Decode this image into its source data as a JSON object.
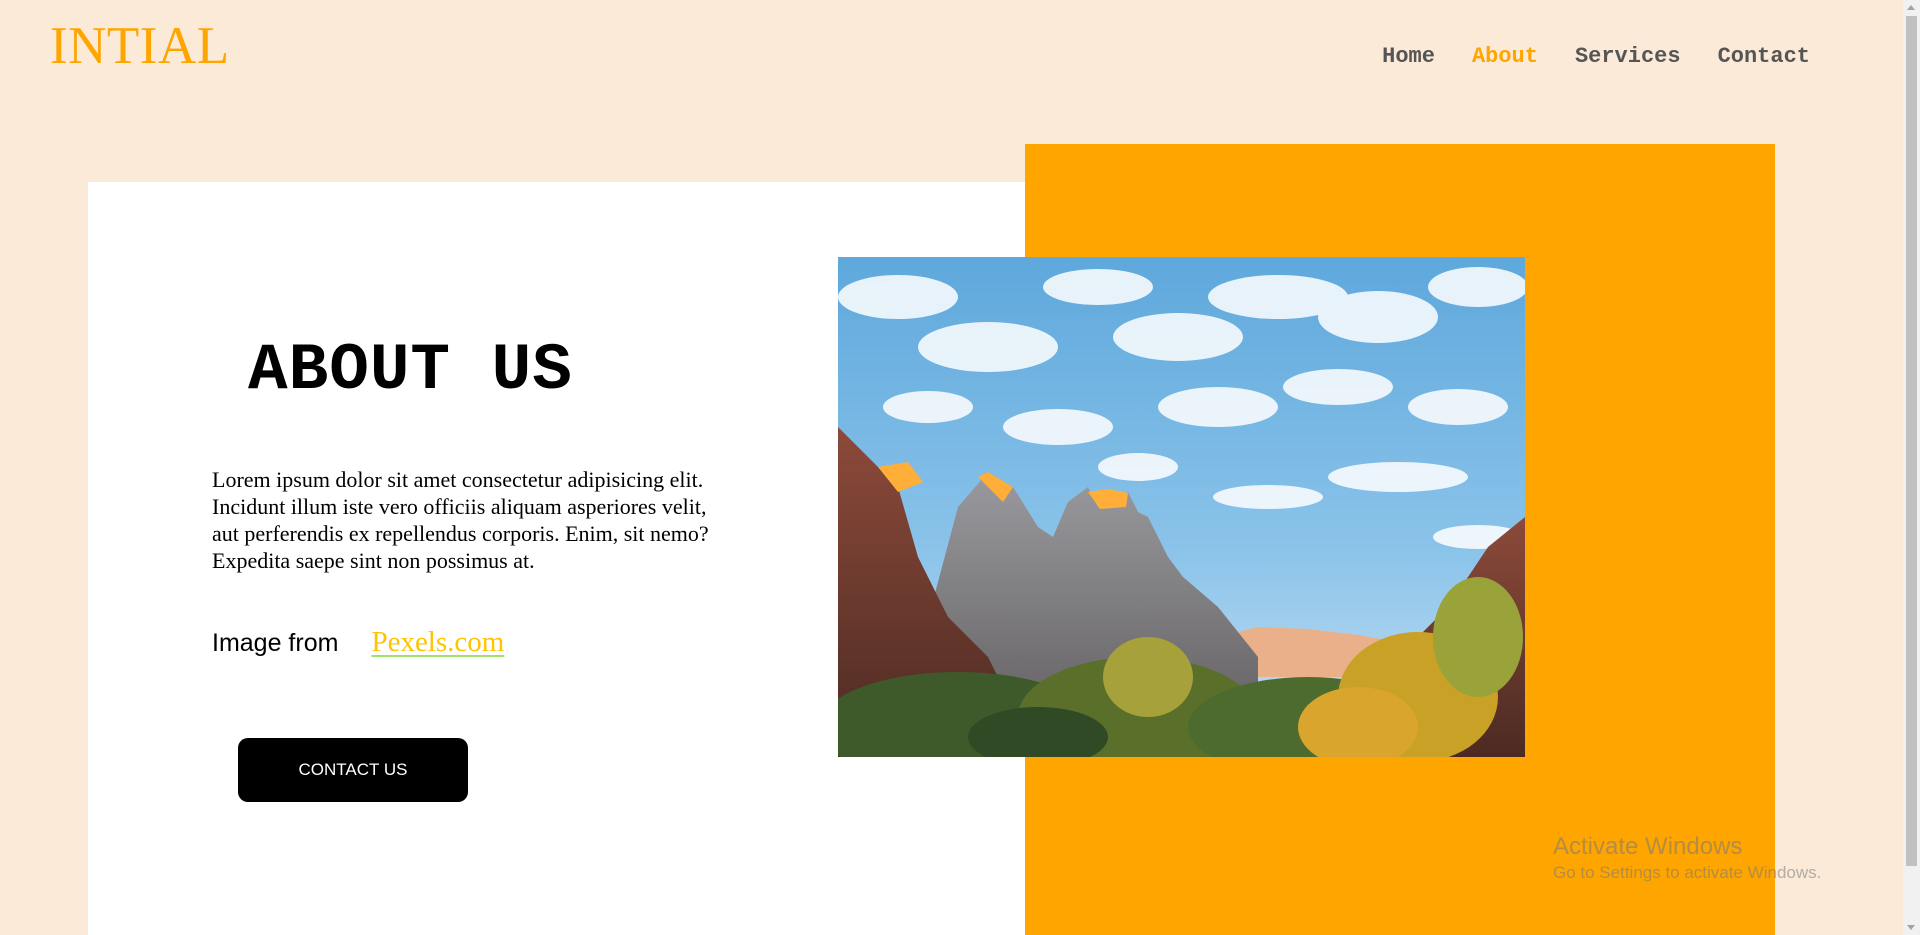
{
  "brand": {
    "logo": "INTIAL",
    "accent_color": "#ffa500",
    "background_color": "#faead7"
  },
  "nav": {
    "items": [
      {
        "label": "Home",
        "active": false
      },
      {
        "label": "About",
        "active": true
      },
      {
        "label": "Services",
        "active": false
      },
      {
        "label": "Contact",
        "active": false
      }
    ]
  },
  "about": {
    "title": "ABOUT US",
    "body": "Lorem ipsum dolor sit amet consectetur adipisicing elit. Incidunt illum iste vero officiis aliquam asperiores velit, aut perferendis ex repellendus corporis. Enim, sit nemo? Expedita saepe sint non possimus at.",
    "credit_label": "Image from",
    "credit_link": "Pexels.com",
    "button_label": "CONTACT US"
  },
  "image": {
    "icon": "landscape-photo",
    "subject": "mountain landscape"
  },
  "watermark": {
    "title": "Activate Windows",
    "subtitle": "Go to Settings to activate Windows."
  }
}
